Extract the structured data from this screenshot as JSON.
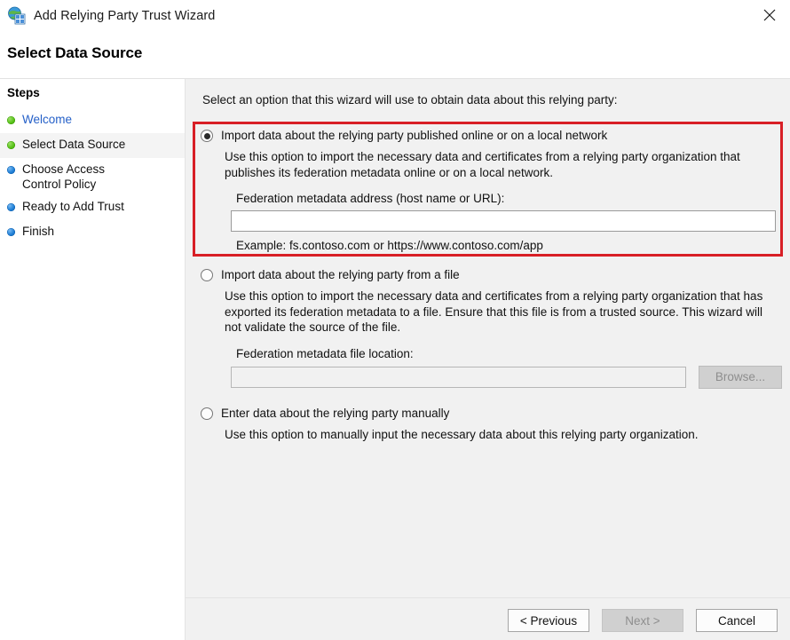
{
  "window": {
    "title": "Add Relying Party Trust Wizard",
    "icon": "relying-party-trust-icon",
    "close_label": "✕"
  },
  "page": {
    "heading": "Select Data Source"
  },
  "sidebar": {
    "title": "Steps",
    "items": [
      {
        "label": "Welcome",
        "state": "done",
        "style": "link"
      },
      {
        "label": "Select Data Source",
        "state": "done",
        "style": "current"
      },
      {
        "label": "Choose Access Control Policy",
        "state": "pending",
        "style": "normal"
      },
      {
        "label": "Ready to Add Trust",
        "state": "pending",
        "style": "normal"
      },
      {
        "label": "Finish",
        "state": "pending",
        "style": "normal"
      }
    ]
  },
  "main": {
    "intro": "Select an option that this wizard will use to obtain data about this relying party:",
    "options": [
      {
        "title": "Import data about the relying party published online or on a local network",
        "description": "Use this option to import the necessary data and certificates from a relying party organization that publishes its federation metadata online or on a local network.",
        "field_label": "Federation metadata address (host name or URL):",
        "field_value": "",
        "field_placeholder": "",
        "example": "Example: fs.contoso.com or https://www.contoso.com/app",
        "selected": true
      },
      {
        "title": "Import data about the relying party from a file",
        "description": "Use this option to import the necessary data and certificates from a relying party organization that has exported its federation metadata to a file. Ensure that this file is from a trusted source.  This wizard will not validate the source of the file.",
        "field_label": "Federation metadata file location:",
        "field_value": "",
        "field_placeholder": "",
        "browse_label": "Browse...",
        "selected": false
      },
      {
        "title": "Enter data about the relying party manually",
        "description": "Use this option to manually input the necessary data about this relying party organization.",
        "selected": false
      }
    ],
    "highlight_color": "#d81f26"
  },
  "footer": {
    "previous_label": "< Previous",
    "next_label": "Next >",
    "cancel_label": "Cancel"
  }
}
